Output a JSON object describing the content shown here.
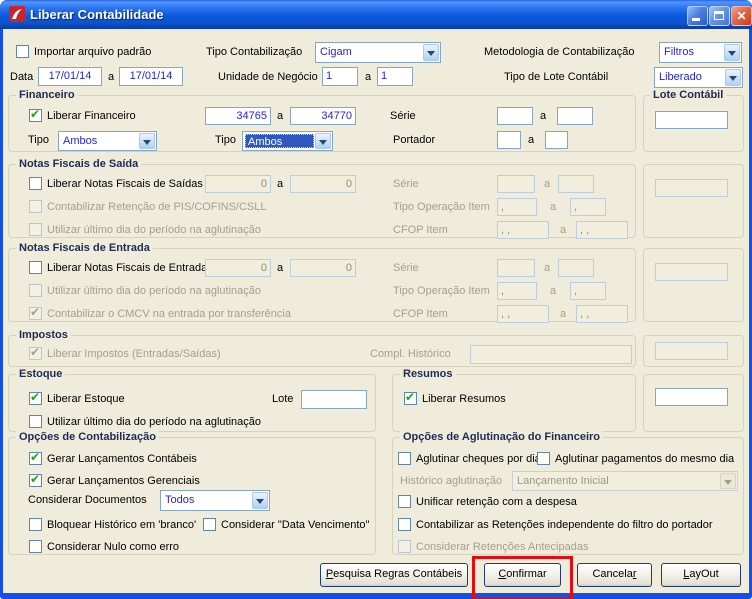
{
  "icons": {
    "check": "✔",
    "close": "✕"
  },
  "sep": {
    "a": "a"
  },
  "window": {
    "title": "Liberar Contabilidade"
  },
  "top": {
    "importar": "Importar arquivo padrão",
    "tipo_label": "Tipo Contabilização",
    "tipo_value": "Cigam",
    "metodologia_label": "Metodologia de Contabilização",
    "metodologia_value": "Filtros"
  },
  "filtros": {
    "data_label": "Data",
    "data_from": "17/01/14",
    "data_to": "17/01/14",
    "unidade_label": "Unidade de Negócio",
    "unidade_from": "1",
    "unidade_to": "1",
    "lote_label": "Tipo de Lote Contábil",
    "lote_value": "Liberado"
  },
  "financeiro": {
    "legend": "Financeiro",
    "liberar": "Liberar Financeiro",
    "from": "34765",
    "to": "34770",
    "serie": "Série",
    "tipo": "Tipo",
    "tipo1_value": "Ambos",
    "tipo2_value": "Ambos",
    "portador": "Portador"
  },
  "lote": {
    "legend": "Lote Contábil"
  },
  "saida": {
    "legend": "Notas Fiscais de Saída",
    "liberar": "Liberar Notas Fiscais de Saídas",
    "from": "0",
    "to": "0",
    "serie": "Série",
    "retencao": "Contabilizar Retenção de PIS/COFINS/CSLL",
    "tipo_op": "Tipo Operação Item",
    "tipo_op_from": ",",
    "tipo_op_to": ",",
    "ultimo": "Utilizar último dia do período na aglutinação",
    "cfop": "CFOP Item",
    "cfop_from": ", ,",
    "cfop_to": ", ,"
  },
  "entrada": {
    "legend": "Notas Fiscais de Entrada",
    "liberar": "Liberar Notas Fiscais de Entrada",
    "from": "0",
    "to": "0",
    "serie": "Série",
    "ultimo": "Utilizar último dia do período na aglutinação",
    "cmcv": "Contabilizar o CMCV na entrada por transferência",
    "tipo_op": "Tipo Operação Item",
    "tipo_op_from": ",",
    "tipo_op_to": ",",
    "cfop": "CFOP Item",
    "cfop_from": ", ,",
    "cfop_to": ", ,"
  },
  "impostos": {
    "legend": "Impostos",
    "liberar": "Liberar Impostos (Entradas/Saídas)",
    "compl": "Compl. Histórico"
  },
  "estoque": {
    "legend": "Estoque",
    "liberar": "Liberar Estoque",
    "lote": "Lote",
    "ultimo": "Utilizar último dia do período na aglutinação"
  },
  "resumos": {
    "legend": "Resumos",
    "liberar": "Liberar Resumos"
  },
  "op_cont": {
    "legend": "Opções de Contabilização",
    "contabeis": "Gerar Lançamentos Contábeis",
    "gerenciais": "Gerar Lançamentos Gerenciais",
    "docs_label": "Considerar Documentos",
    "docs_value": "Todos",
    "bloquear": "Bloquear Histórico em 'branco'",
    "data_venc": "Considerar \"Data Vencimento\"",
    "nulo": "Considerar Nulo como erro"
  },
  "op_agl": {
    "legend": "Opções de Aglutinação do Financeiro",
    "cheques": "Aglutinar cheques por dia",
    "pagamentos": "Aglutinar pagamentos do mesmo dia",
    "historico_label": "Histórico aglutinação",
    "historico_value": "Lançamento Inicial",
    "unificar": "Unificar retenção com a despesa",
    "retencoes": "Contabilizar as Retenções independente do filtro do portador",
    "antecipadas": "Considerar Retenções Antecipadas"
  },
  "buttons": {
    "pesquisa": {
      "pre": "",
      "u": "P",
      "post": "esquisa Regras Contábeis"
    },
    "confirmar": {
      "pre": "",
      "u": "C",
      "post": "onfirmar"
    },
    "cancelar": {
      "pre": "Cancela",
      "u": "r",
      "post": ""
    },
    "layout": {
      "pre": "",
      "u": "L",
      "post": "ayOut"
    }
  },
  "colors": {
    "titlebar_blue": "#0b58dc",
    "annotation_red": "#e50b12",
    "value_text": "#2626cc",
    "check_green": "#1da120"
  }
}
